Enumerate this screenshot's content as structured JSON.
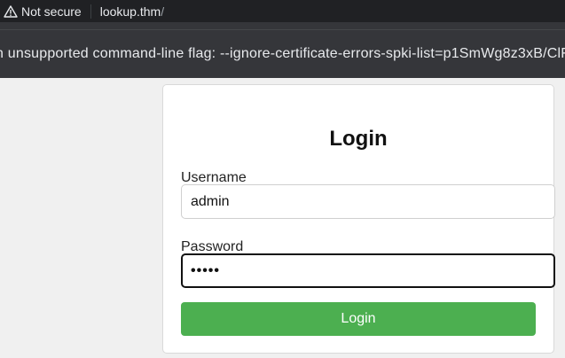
{
  "browser": {
    "security_label": "Not secure",
    "url_host": "lookup.thm",
    "url_path": "/"
  },
  "infobar": {
    "message": "n unsupported command-line flag: --ignore-certificate-errors-spki-list=p1SmWg8z3xB/ClF"
  },
  "login": {
    "title": "Login",
    "username_label": "Username",
    "username_value": "admin",
    "password_label": "Password",
    "password_masked": "•••••",
    "submit_label": "Login"
  }
}
